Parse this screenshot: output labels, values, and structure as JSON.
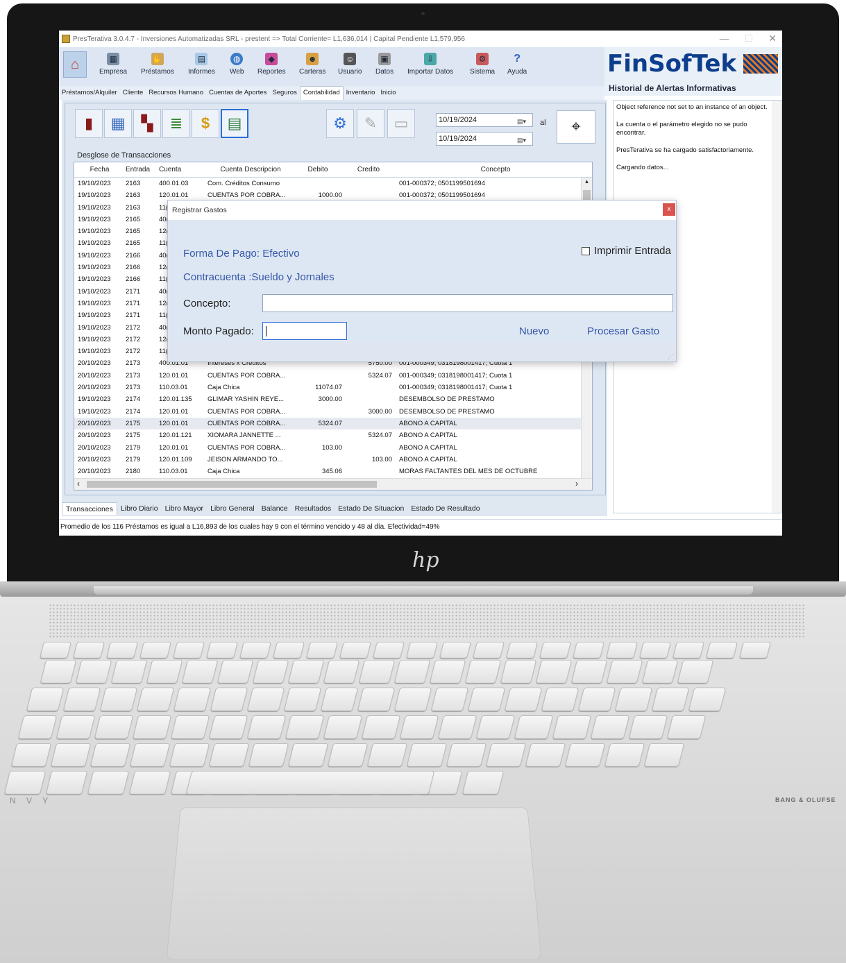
{
  "window": {
    "title": "PresTerativa 3.0.4.7 - Inversiones Automatizadas SRL - prestent => Total Corriente= L1,636,014 | Capital Pendiente L1,579,956",
    "controls": [
      "—",
      "☐",
      "✕"
    ]
  },
  "ribbon": {
    "items": [
      {
        "label": "Empresa",
        "icon": "building-icon"
      },
      {
        "label": "Préstamos",
        "icon": "handshake-icon"
      },
      {
        "label": "Informes",
        "icon": "report-icon"
      },
      {
        "label": "Web",
        "icon": "globe-icon"
      },
      {
        "label": "Reportes",
        "icon": "chart-icon"
      },
      {
        "label": "Carteras",
        "icon": "people-icon"
      },
      {
        "label": "Usuario",
        "icon": "user-icon"
      },
      {
        "label": "Datos",
        "icon": "data-icon"
      },
      {
        "label": "Importar Datos",
        "icon": "import-icon"
      },
      {
        "label": "Sistema",
        "icon": "system-icon"
      },
      {
        "label": "Ayuda",
        "icon": "help-icon"
      }
    ]
  },
  "brand": {
    "name": "FinSofTek",
    "subtitle": "Historial de Alertas Informativas"
  },
  "nav_tabs": [
    "Préstamos/Alquiler",
    "Cliente",
    "Recursos Humano",
    "Cuentas de Aportes",
    "Seguros",
    "Contabilidad",
    "Inventario",
    "Inicio"
  ],
  "active_nav_tab": "Contabilidad",
  "filters": {
    "date_from": "10/19/2024",
    "date_to": "10/19/2024",
    "al_label": "al"
  },
  "grid": {
    "title": "Desglose de Transacciones",
    "columns": [
      "Fecha",
      "Entrada",
      "Cuenta",
      "Cuenta Descripcion",
      "Debito",
      "Credito",
      "Concepto"
    ],
    "rows": [
      [
        "19/10/2023",
        "2163",
        "400.01.03",
        "Com. Créditos Consumo",
        "",
        "",
        "001-000372; 0501199501694"
      ],
      [
        "19/10/2023",
        "2163",
        "120.01.01",
        "CUENTAS POR COBRA...",
        "1000.00",
        "",
        "001-000372; 0501199501694"
      ],
      [
        "19/10/2023",
        "2163",
        "11(",
        "",
        "",
        "",
        ""
      ],
      [
        "19/10/2023",
        "2165",
        "40(",
        "",
        "",
        "",
        ""
      ],
      [
        "19/10/2023",
        "2165",
        "12(",
        "",
        "",
        "",
        ""
      ],
      [
        "19/10/2023",
        "2165",
        "11(",
        "",
        "",
        "",
        ""
      ],
      [
        "19/10/2023",
        "2166",
        "40(",
        "",
        "",
        "",
        ""
      ],
      [
        "19/10/2023",
        "2166",
        "12(",
        "",
        "",
        "",
        ""
      ],
      [
        "19/10/2023",
        "2166",
        "11(",
        "",
        "",
        "",
        ""
      ],
      [
        "19/10/2023",
        "2171",
        "40(",
        "",
        "",
        "",
        ""
      ],
      [
        "19/10/2023",
        "2171",
        "12(",
        "",
        "",
        "",
        ""
      ],
      [
        "19/10/2023",
        "2171",
        "11(",
        "",
        "",
        "",
        ""
      ],
      [
        "19/10/2023",
        "2172",
        "40(",
        "",
        "",
        "",
        ""
      ],
      [
        "19/10/2023",
        "2172",
        "12(",
        "",
        "",
        "",
        ""
      ],
      [
        "19/10/2023",
        "2172",
        "11(",
        "",
        "",
        "",
        ""
      ],
      [
        "20/10/2023",
        "2173",
        "400.01.01",
        "Intereses x Creditos",
        "",
        "5750.00",
        "001-000349; 0318198001417; Cuota 1"
      ],
      [
        "20/10/2023",
        "2173",
        "120.01.01",
        "CUENTAS POR COBRA...",
        "",
        "5324.07",
        "001-000349; 0318198001417; Cuota 1"
      ],
      [
        "20/10/2023",
        "2173",
        "110.03.01",
        "Caja Chica",
        "11074.07",
        "",
        "001-000349; 0318198001417; Cuota 1"
      ],
      [
        "19/10/2023",
        "2174",
        "120.01.135",
        "GLIMAR YASHIN REYE...",
        "3000.00",
        "",
        "DESEMBOLSO DE PRESTAMO"
      ],
      [
        "19/10/2023",
        "2174",
        "120.01.01",
        "CUENTAS POR COBRA...",
        "",
        "3000.00",
        "DESEMBOLSO DE PRESTAMO"
      ],
      [
        "20/10/2023",
        "2175",
        "120.01.01",
        "CUENTAS POR COBRA...",
        "5324.07",
        "",
        "ABONO A CAPITAL"
      ],
      [
        "20/10/2023",
        "2175",
        "120.01.121",
        "XIOMARA JANNETTE ...",
        "",
        "5324.07",
        "ABONO A CAPITAL"
      ],
      [
        "20/10/2023",
        "2179",
        "120.01.01",
        "CUENTAS POR COBRA...",
        "103.00",
        "",
        "ABONO A CAPITAL"
      ],
      [
        "20/10/2023",
        "2179",
        "120.01.109",
        "JEISON ARMANDO TO...",
        "",
        "103.00",
        "ABONO A CAPITAL"
      ],
      [
        "20/10/2023",
        "2180",
        "110.03.01",
        "Caja Chica",
        "345.06",
        "",
        "MORAS FALTANTES DEL MES DE OCTUBRE"
      ]
    ],
    "highlight_row": 20
  },
  "bottom_tabs": [
    "Transacciones",
    "Libro Diario",
    "Libro Mayor",
    "Libro General",
    "Balance",
    "Resultados",
    "Estado De Situacion",
    "Estado De Resultado"
  ],
  "alerts": [
    "Object reference not set to an instance of an object.",
    "La cuenta o el parámetro elegido no se pudo encontrar.",
    "PresTerativa se ha cargado satisfactoriamente.",
    "Cargando datos..."
  ],
  "status": "Promedio de los 116 Préstamos es igual a L16,893 de los cuales hay 9 con el término vencido y 48 al día.  Efectividad=49%",
  "dialog": {
    "title": "Registrar Gastos",
    "close": "x",
    "forma_pago": "Forma De Pago: Efectivo",
    "contracuenta": "Contracuenta :Sueldo y Jornales",
    "print_label": "Imprimir Entrada",
    "concepto_label": "Concepto:",
    "concepto_value": "",
    "monto_label": "Monto Pagado:",
    "monto_value": "",
    "nuevo": "Nuevo",
    "procesar": "Procesar Gasto"
  },
  "laptop": {
    "brand_left": "N V Y",
    "brand_right": "BANG & OLUFSE",
    "logo": "hp"
  }
}
